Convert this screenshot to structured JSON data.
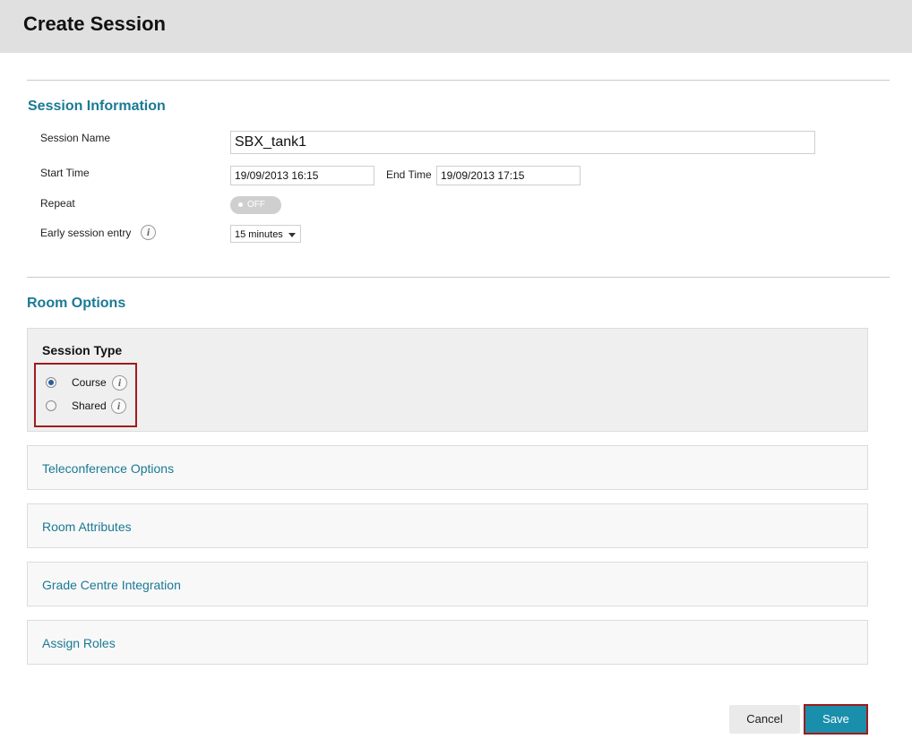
{
  "header": {
    "title": "Create Session"
  },
  "session_information": {
    "title": "Session Information",
    "session_name_label": "Session Name",
    "session_name_value": "SBX_tank1",
    "start_time_label": "Start Time",
    "start_time_value": "19/09/2013 16:15",
    "end_time_label": "End Time",
    "end_time_value": "19/09/2013 17:15",
    "repeat_label": "Repeat",
    "repeat_toggle": "OFF",
    "early_entry_label": "Early session entry",
    "early_entry_value": "15 minutes",
    "info_glyph": "i"
  },
  "room_options": {
    "title": "Room Options",
    "session_type": {
      "title": "Session Type",
      "options": [
        {
          "label": "Course",
          "checked": true
        },
        {
          "label": "Shared",
          "checked": false
        }
      ]
    },
    "accordions": [
      {
        "label": "Teleconference Options"
      },
      {
        "label": "Room Attributes"
      },
      {
        "label": "Grade Centre Integration"
      },
      {
        "label": "Assign Roles"
      }
    ]
  },
  "footer": {
    "cancel_label": "Cancel",
    "save_label": "Save"
  },
  "colors": {
    "accent": "#1a7a94",
    "save_button": "#1a8fab",
    "highlight": "#9e1c1c"
  }
}
